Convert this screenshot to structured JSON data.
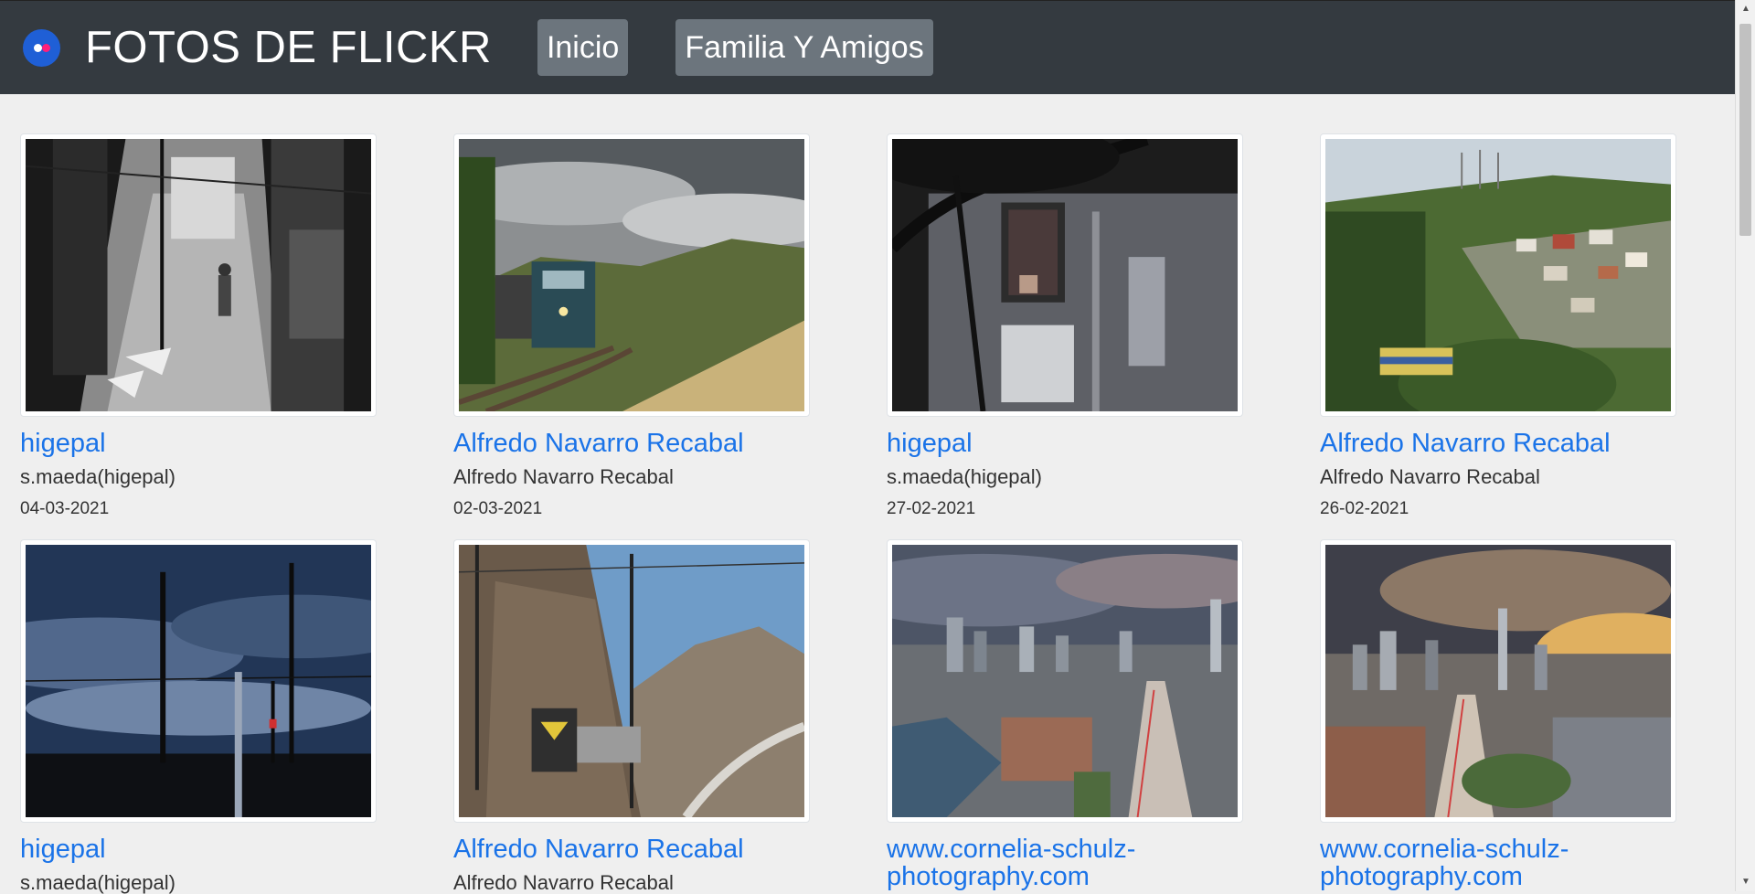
{
  "header": {
    "brand": "FOTOS DE FLICKR",
    "nav": [
      {
        "label": "Inicio"
      },
      {
        "label": "Familia Y Amigos"
      }
    ],
    "colors": {
      "bar": "#343a40",
      "button": "#6c757d",
      "logo": "#1f5fd6",
      "logo_dot": "#ff1f7a"
    }
  },
  "photos": [
    {
      "link": "higepal",
      "owner": "s.maeda(higepal)",
      "date": "04-03-2021",
      "scene": "black and white street with pedestrian"
    },
    {
      "link": "Alfredo Navarro Recabal",
      "owner": "Alfredo Navarro Recabal",
      "date": "02-03-2021",
      "scene": "locomotive on curved track under cloudy sky"
    },
    {
      "link": "higepal",
      "owner": "s.maeda(higepal)",
      "date": "27-02-2021",
      "scene": "dark building wall with window and tree"
    },
    {
      "link": "Alfredo Navarro Recabal",
      "owner": "Alfredo Navarro Recabal",
      "date": "26-02-2021",
      "scene": "train passing hillside town with trees"
    },
    {
      "link": "higepal",
      "owner": "s.maeda(higepal)",
      "date": "",
      "scene": "utility poles silhouetted under blue sky"
    },
    {
      "link": "Alfredo Navarro Recabal",
      "owner": "Alfredo Navarro Recabal",
      "date": "",
      "scene": "train in mountain valley"
    },
    {
      "link": "www.cornelia-schulz-photography.com",
      "owner": "",
      "date": "",
      "scene": "city skyline aerial at dusk"
    },
    {
      "link": "www.cornelia-schulz-photography.com",
      "owner": "",
      "date": "",
      "scene": "city skyline aerial at sunset"
    }
  ],
  "link_color": "#1a73e8"
}
